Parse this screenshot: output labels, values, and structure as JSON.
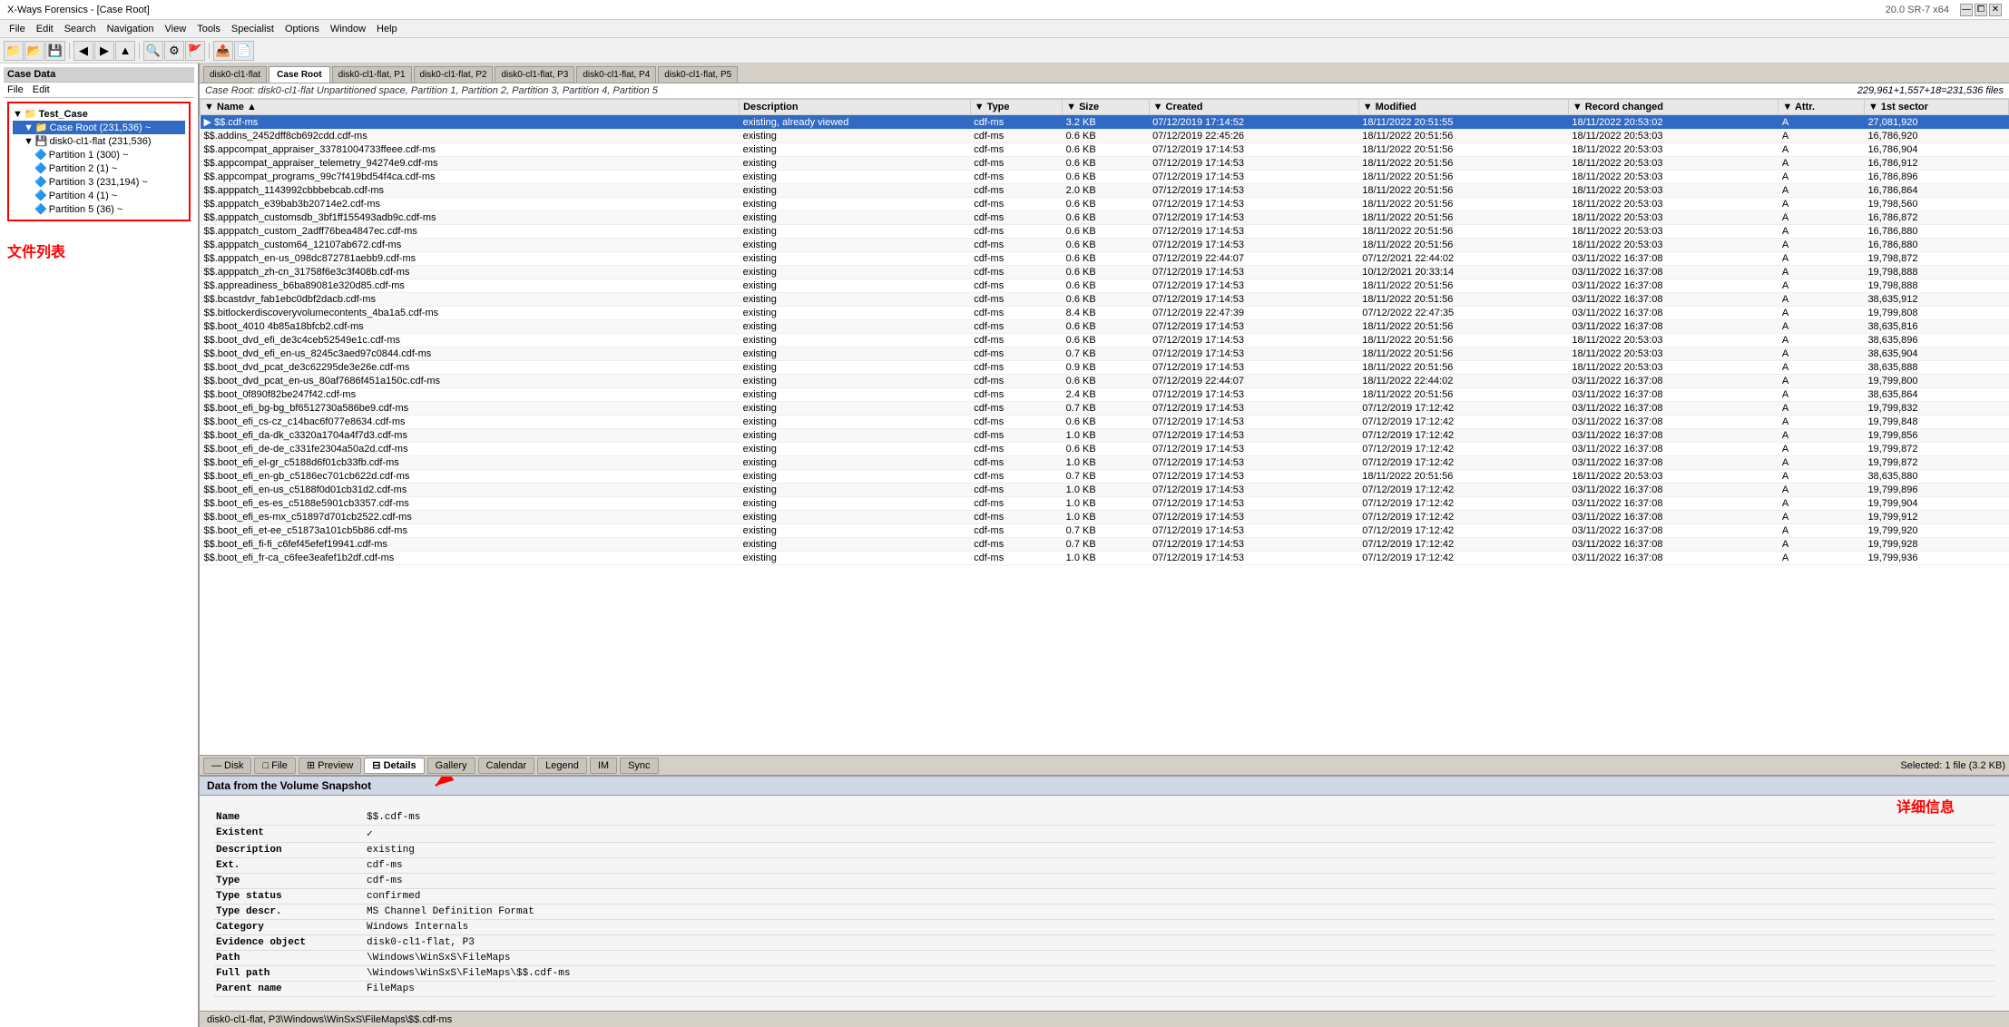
{
  "titlebar": {
    "title": "X-Ways Forensics - [Case Root]",
    "version": "20.0 SR-7 x64",
    "controls": [
      "—",
      "⧠",
      "✕"
    ]
  },
  "menubar": {
    "items": [
      "File",
      "Edit",
      "Search",
      "Navigation",
      "View",
      "Tools",
      "Specialist",
      "Options",
      "Window",
      "Help"
    ]
  },
  "left_panel": {
    "header": "Case Data",
    "menu": [
      "File",
      "Edit"
    ],
    "tree": [
      {
        "label": "Test_Case",
        "indent": 0,
        "icon": "📁"
      },
      {
        "label": "Case Root (231,536)",
        "indent": 1,
        "icon": "📁"
      },
      {
        "label": "disk0-cl1-flat (231,536)",
        "indent": 1,
        "icon": "💾"
      },
      {
        "label": "Partition 1 (300)",
        "indent": 2,
        "icon": "📂"
      },
      {
        "label": "Partition 2 (1)",
        "indent": 2,
        "icon": "📂"
      },
      {
        "label": "Partition 3 (231,194)",
        "indent": 2,
        "icon": "📂"
      },
      {
        "label": "Partition 4 (1)",
        "indent": 2,
        "icon": "📂"
      },
      {
        "label": "Partition 5 (36)",
        "indent": 2,
        "icon": "📂"
      }
    ],
    "annotation": "文件列表"
  },
  "tabbar": {
    "tabs": [
      "disk0-cl1-flat",
      "Case Root",
      "disk0-cl1-flat, P1",
      "disk0-cl1-flat, P2",
      "disk0-cl1-flat, P3",
      "disk0-cl1-flat, P4",
      "disk0-cl1-flat, P5"
    ],
    "active": 1
  },
  "breadcrumb": {
    "text": "Case Root: disk0-cl1-flat Unpartitioned space, Partition 1, Partition 2, Partition 3, Partition 4, Partition 5",
    "file_count": "229,961+1,557+18=231,536 files"
  },
  "filelist": {
    "columns": [
      "Name",
      "Description",
      "Type",
      "Size",
      "Created",
      "Modified",
      "Record changed",
      "Attr.",
      "1st sector"
    ],
    "rows": [
      {
        "name": "$$.cdf-ms",
        "desc": "existing, already viewed",
        "type": "cdf-ms",
        "size": "3.2 KB",
        "created": "07/12/2019 17:14:52",
        "modified": "18/11/2022 20:51:55",
        "record_changed": "18/11/2022 20:53:02",
        "attr": "A",
        "sector": "27,081,920",
        "selected": true
      },
      {
        "name": "$$.addins_2452dff8cb692cdd.cdf-ms",
        "desc": "existing",
        "type": "cdf-ms",
        "size": "0.6 KB",
        "created": "07/12/2019 22:45:26",
        "modified": "18/11/2022 20:51:56",
        "record_changed": "18/11/2022 20:53:03",
        "attr": "A",
        "sector": "16,786,920"
      },
      {
        "name": "$$.appcompat_appraiser_33781004733ffeee.cdf-ms",
        "desc": "existing",
        "type": "cdf-ms",
        "size": "0.6 KB",
        "created": "07/12/2019 17:14:53",
        "modified": "18/11/2022 20:51:56",
        "record_changed": "18/11/2022 20:53:03",
        "attr": "A",
        "sector": "16,786,904"
      },
      {
        "name": "$$.appcompat_appraiser_telemetry_94274e9.cdf-ms",
        "desc": "existing",
        "type": "cdf-ms",
        "size": "0.6 KB",
        "created": "07/12/2019 17:14:53",
        "modified": "18/11/2022 20:51:56",
        "record_changed": "18/11/2022 20:53:03",
        "attr": "A",
        "sector": "16,786,912"
      },
      {
        "name": "$$.appcompat_programs_99c7f419bd54f4ca.cdf-ms",
        "desc": "existing",
        "type": "cdf-ms",
        "size": "0.6 KB",
        "created": "07/12/2019 17:14:53",
        "modified": "18/11/2022 20:51:56",
        "record_changed": "18/11/2022 20:53:03",
        "attr": "A",
        "sector": "16,786,896"
      },
      {
        "name": "$$.apppatch_1143992cbbbebcab.cdf-ms",
        "desc": "existing",
        "type": "cdf-ms",
        "size": "2.0 KB",
        "created": "07/12/2019 17:14:53",
        "modified": "18/11/2022 20:51:56",
        "record_changed": "18/11/2022 20:53:03",
        "attr": "A",
        "sector": "16,786,864"
      },
      {
        "name": "$$.apppatch_e39bab3b20714e2.cdf-ms",
        "desc": "existing",
        "type": "cdf-ms",
        "size": "0.6 KB",
        "created": "07/12/2019 17:14:53",
        "modified": "18/11/2022 20:51:56",
        "record_changed": "18/11/2022 20:53:03",
        "attr": "A",
        "sector": "19,798,560"
      },
      {
        "name": "$$.apppatch_customsdb_3bf1ff155493adb9c.cdf-ms",
        "desc": "existing",
        "type": "cdf-ms",
        "size": "0.6 KB",
        "created": "07/12/2019 17:14:53",
        "modified": "18/11/2022 20:51:56",
        "record_changed": "18/11/2022 20:53:03",
        "attr": "A",
        "sector": "16,786,872"
      },
      {
        "name": "$$.apppatch_custom_2adff76bea4847ec.cdf-ms",
        "desc": "existing",
        "type": "cdf-ms",
        "size": "0.6 KB",
        "created": "07/12/2019 17:14:53",
        "modified": "18/11/2022 20:51:56",
        "record_changed": "18/11/2022 20:53:03",
        "attr": "A",
        "sector": "16,786,880"
      },
      {
        "name": "$$.apppatch_custom64_12107ab672.cdf-ms",
        "desc": "existing",
        "type": "cdf-ms",
        "size": "0.6 KB",
        "created": "07/12/2019 17:14:53",
        "modified": "18/11/2022 20:51:56",
        "record_changed": "18/11/2022 20:53:03",
        "attr": "A",
        "sector": "16,786,880"
      },
      {
        "name": "$$.apppatch_en-us_098dc872781aebb9.cdf-ms",
        "desc": "existing",
        "type": "cdf-ms",
        "size": "0.6 KB",
        "created": "07/12/2019 22:44:07",
        "modified": "07/12/2021 22:44:02",
        "record_changed": "03/11/2022 16:37:08",
        "attr": "A",
        "sector": "19,798,872"
      },
      {
        "name": "$$.apppatch_zh-cn_31758f6e3c3f408b.cdf-ms",
        "desc": "existing",
        "type": "cdf-ms",
        "size": "0.6 KB",
        "created": "07/12/2019 17:14:53",
        "modified": "10/12/2021 20:33:14",
        "record_changed": "03/11/2022 16:37:08",
        "attr": "A",
        "sector": "19,798,888"
      },
      {
        "name": "$$.appreadiness_b6ba89081e320d85.cdf-ms",
        "desc": "existing",
        "type": "cdf-ms",
        "size": "0.6 KB",
        "created": "07/12/2019 17:14:53",
        "modified": "18/11/2022 20:51:56",
        "record_changed": "03/11/2022 16:37:08",
        "attr": "A",
        "sector": "19,798,888"
      },
      {
        "name": "$$.bcastdvr_fab1ebc0dbf2dacb.cdf-ms",
        "desc": "existing",
        "type": "cdf-ms",
        "size": "0.6 KB",
        "created": "07/12/2019 17:14:53",
        "modified": "18/11/2022 20:51:56",
        "record_changed": "03/11/2022 16:37:08",
        "attr": "A",
        "sector": "38,635,912"
      },
      {
        "name": "$$.bitlockerdiscoveryvolumecontents_4ba1a5.cdf-ms",
        "desc": "existing",
        "type": "cdf-ms",
        "size": "8.4 KB",
        "created": "07/12/2019 22:47:39",
        "modified": "07/12/2022 22:47:35",
        "record_changed": "03/11/2022 16:37:08",
        "attr": "A",
        "sector": "19,799,808"
      },
      {
        "name": "$$.boot_4010 4b85a18bfcb2.cdf-ms",
        "desc": "existing",
        "type": "cdf-ms",
        "size": "0.6 KB",
        "created": "07/12/2019 17:14:53",
        "modified": "18/11/2022 20:51:56",
        "record_changed": "03/11/2022 16:37:08",
        "attr": "A",
        "sector": "38,635,816"
      },
      {
        "name": "$$.boot_dvd_efi_de3c4ceb52549e1c.cdf-ms",
        "desc": "existing",
        "type": "cdf-ms",
        "size": "0.6 KB",
        "created": "07/12/2019 17:14:53",
        "modified": "18/11/2022 20:51:56",
        "record_changed": "18/11/2022 20:53:03",
        "attr": "A",
        "sector": "38,635,896"
      },
      {
        "name": "$$.boot_dvd_efi_en-us_8245c3aed97c0844.cdf-ms",
        "desc": "existing",
        "type": "cdf-ms",
        "size": "0.7 KB",
        "created": "07/12/2019 17:14:53",
        "modified": "18/11/2022 20:51:56",
        "record_changed": "18/11/2022 20:53:03",
        "attr": "A",
        "sector": "38,635,904"
      },
      {
        "name": "$$.boot_dvd_pcat_de3c62295de3e26e.cdf-ms",
        "desc": "existing",
        "type": "cdf-ms",
        "size": "0.9 KB",
        "created": "07/12/2019 17:14:53",
        "modified": "18/11/2022 20:51:56",
        "record_changed": "18/11/2022 20:53:03",
        "attr": "A",
        "sector": "38,635,888"
      },
      {
        "name": "$$.boot_dvd_pcat_en-us_80af7686f451a150c.cdf-ms",
        "desc": "existing",
        "type": "cdf-ms",
        "size": "0.6 KB",
        "created": "07/12/2019 22:44:07",
        "modified": "18/11/2022 22:44:02",
        "record_changed": "03/11/2022 16:37:08",
        "attr": "A",
        "sector": "19,799,800"
      },
      {
        "name": "$$.boot_0f890f82be247f42.cdf-ms",
        "desc": "existing",
        "type": "cdf-ms",
        "size": "2.4 KB",
        "created": "07/12/2019 17:14:53",
        "modified": "18/11/2022 20:51:56",
        "record_changed": "03/11/2022 16:37:08",
        "attr": "A",
        "sector": "38,635,864"
      },
      {
        "name": "$$.boot_efi_bg-bg_bf6512730a586be9.cdf-ms",
        "desc": "existing",
        "type": "cdf-ms",
        "size": "0.7 KB",
        "created": "07/12/2019 17:14:53",
        "modified": "07/12/2019 17:12:42",
        "record_changed": "03/11/2022 16:37:08",
        "attr": "A",
        "sector": "19,799,832"
      },
      {
        "name": "$$.boot_efi_cs-cz_c14bac6f077e8634.cdf-ms",
        "desc": "existing",
        "type": "cdf-ms",
        "size": "0.6 KB",
        "created": "07/12/2019 17:14:53",
        "modified": "07/12/2019 17:12:42",
        "record_changed": "03/11/2022 16:37:08",
        "attr": "A",
        "sector": "19,799,848"
      },
      {
        "name": "$$.boot_efi_da-dk_c3320a1704a4f7d3.cdf-ms",
        "desc": "existing",
        "type": "cdf-ms",
        "size": "1.0 KB",
        "created": "07/12/2019 17:14:53",
        "modified": "07/12/2019 17:12:42",
        "record_changed": "03/11/2022 16:37:08",
        "attr": "A",
        "sector": "19,799,856"
      },
      {
        "name": "$$.boot_efi_de-de_c331fe2304a50a2d.cdf-ms",
        "desc": "existing",
        "type": "cdf-ms",
        "size": "0.6 KB",
        "created": "07/12/2019 17:14:53",
        "modified": "07/12/2019 17:12:42",
        "record_changed": "03/11/2022 16:37:08",
        "attr": "A",
        "sector": "19,799,872"
      },
      {
        "name": "$$.boot_efi_el-gr_c5188d6f01cb33fb.cdf-ms",
        "desc": "existing",
        "type": "cdf-ms",
        "size": "1.0 KB",
        "created": "07/12/2019 17:14:53",
        "modified": "07/12/2019 17:12:42",
        "record_changed": "03/11/2022 16:37:08",
        "attr": "A",
        "sector": "19,799,872"
      },
      {
        "name": "$$.boot_efi_en-gb_c5186ec701cb622d.cdf-ms",
        "desc": "existing",
        "type": "cdf-ms",
        "size": "0.7 KB",
        "created": "07/12/2019 17:14:53",
        "modified": "18/11/2022 20:51:56",
        "record_changed": "18/11/2022 20:53:03",
        "attr": "A",
        "sector": "38,635,880"
      },
      {
        "name": "$$.boot_efi_en-us_c5188f0d01cb31d2.cdf-ms",
        "desc": "existing",
        "type": "cdf-ms",
        "size": "1.0 KB",
        "created": "07/12/2019 17:14:53",
        "modified": "07/12/2019 17:12:42",
        "record_changed": "03/11/2022 16:37:08",
        "attr": "A",
        "sector": "19,799,896"
      },
      {
        "name": "$$.boot_efi_es-es_c5188e5901cb3357.cdf-ms",
        "desc": "existing",
        "type": "cdf-ms",
        "size": "1.0 KB",
        "created": "07/12/2019 17:14:53",
        "modified": "07/12/2019 17:12:42",
        "record_changed": "03/11/2022 16:37:08",
        "attr": "A",
        "sector": "19,799,904"
      },
      {
        "name": "$$.boot_efi_es-mx_c51897d701cb2522.cdf-ms",
        "desc": "existing",
        "type": "cdf-ms",
        "size": "1.0 KB",
        "created": "07/12/2019 17:14:53",
        "modified": "07/12/2019 17:12:42",
        "record_changed": "03/11/2022 16:37:08",
        "attr": "A",
        "sector": "19,799,912"
      },
      {
        "name": "$$.boot_efi_et-ee_c51873a101cb5b86.cdf-ms",
        "desc": "existing",
        "type": "cdf-ms",
        "size": "0.7 KB",
        "created": "07/12/2019 17:14:53",
        "modified": "07/12/2019 17:12:42",
        "record_changed": "03/11/2022 16:37:08",
        "attr": "A",
        "sector": "19,799,920"
      },
      {
        "name": "$$.boot_efi_fi-fi_c6fef45efef19941.cdf-ms",
        "desc": "existing",
        "type": "cdf-ms",
        "size": "0.7 KB",
        "created": "07/12/2019 17:14:53",
        "modified": "07/12/2019 17:12:42",
        "record_changed": "03/11/2022 16:37:08",
        "attr": "A",
        "sector": "19,799,928"
      },
      {
        "name": "$$.boot_efi_fr-ca_c6fee3eafef1b2df.cdf-ms",
        "desc": "existing",
        "type": "cdf-ms",
        "size": "1.0 KB",
        "created": "07/12/2019 17:14:53",
        "modified": "07/12/2019 17:12:42",
        "record_changed": "03/11/2022 16:37:08",
        "attr": "A",
        "sector": "19,799,936"
      }
    ]
  },
  "bottom_tabs": {
    "tabs": [
      "Disk",
      "File",
      "Preview",
      "Details",
      "Gallery",
      "Calendar",
      "Legend",
      "IM",
      "Sync"
    ],
    "active": 3
  },
  "detail_panel": {
    "header": "Data from the Volume Snapshot",
    "annotation": "详细信息",
    "fields": [
      {
        "label": "Name",
        "value": "$$.cdf-ms"
      },
      {
        "label": "Existent",
        "value": "✓"
      },
      {
        "label": "Description",
        "value": "existing"
      },
      {
        "label": "Ext.",
        "value": "cdf-ms"
      },
      {
        "label": "Type",
        "value": "cdf-ms"
      },
      {
        "label": "Type status",
        "value": "confirmed"
      },
      {
        "label": "Type descr.",
        "value": "MS Channel Definition Format"
      },
      {
        "label": "Category",
        "value": "Windows Internals"
      },
      {
        "label": "Evidence object",
        "value": "disk0-cl1-flat, P3"
      },
      {
        "label": "Path",
        "value": "\\Windows\\WinSxS\\FileMaps"
      },
      {
        "label": "Full path",
        "value": "\\Windows\\WinSxS\\FileMaps\\$$.cdf-ms"
      },
      {
        "label": "Parent name",
        "value": "FileMaps"
      }
    ]
  },
  "statusbar": {
    "path": "disk0-cl1-flat, P3\\Windows\\WinSxS\\FileMaps\\$$.cdf-ms",
    "selected": "Selected: 1 file (3.2 KB)"
  }
}
